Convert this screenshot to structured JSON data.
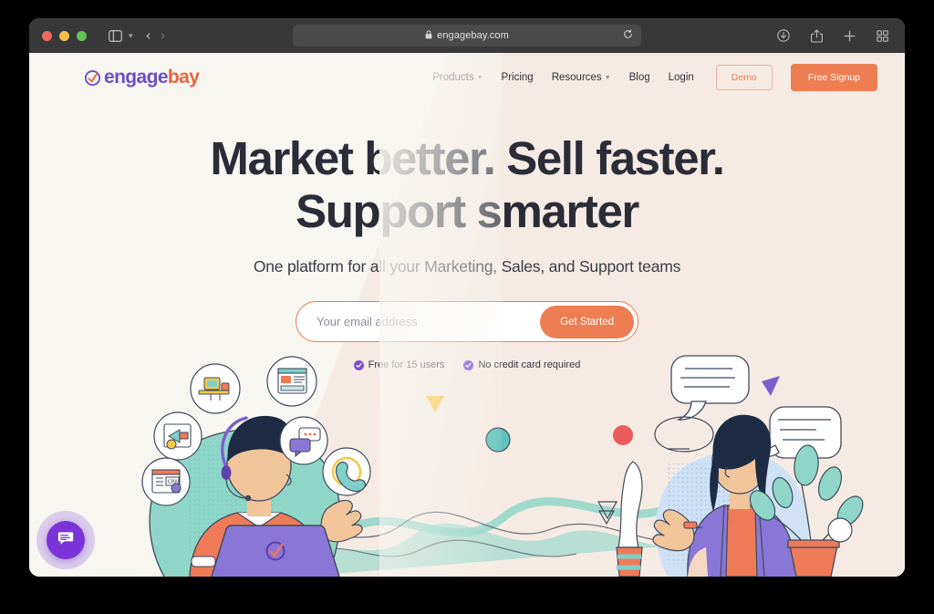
{
  "browser": {
    "url": "engagebay.com",
    "icons": {
      "sidebar": "sidebar-icon",
      "sidebar_caret": "chevron-down-icon",
      "back": "‹",
      "forward": "›",
      "reader": "reader-mode-icon",
      "lock": "lock-icon",
      "reload": "reload-icon",
      "download": "download-icon",
      "share": "share-icon",
      "new_tab": "+",
      "tab_overview": "tab-overview-icon"
    }
  },
  "site": {
    "logo": {
      "part1": "engage",
      "part2": "bay"
    },
    "nav": [
      {
        "label": "Products",
        "has_caret": true
      },
      {
        "label": "Pricing",
        "has_caret": false
      },
      {
        "label": "Resources",
        "has_caret": true
      },
      {
        "label": "Blog",
        "has_caret": false
      },
      {
        "label": "Login",
        "has_caret": false
      }
    ],
    "buttons": {
      "demo": "Demo",
      "signup": "Free Signup"
    }
  },
  "hero": {
    "headline_line1": "Market better. Sell faster.",
    "headline_line2": "Support smarter",
    "subhead": "One platform for all your Marketing, Sales, and Support teams",
    "email_placeholder": "Your email address",
    "email_value": "",
    "cta": "Get Started",
    "badges": [
      "Free for 15 users",
      "No credit card required"
    ]
  },
  "chat": {
    "icon": "chat-bubble-icon"
  },
  "colors": {
    "accent_orange": "#ee7e52",
    "brand_purple": "#6b4fc4",
    "logo_orange": "#e8643c",
    "headline": "#2a2d38",
    "bg_left": "#f7f6f1",
    "bg_right": "#f6ebe4",
    "check_purple": "#7c4dd4",
    "chat_purple": "#7a34d8",
    "mint": "#8fd6c8",
    "teal": "#5fc2bc",
    "illus_purple": "#8a76d6",
    "illus_orange": "#ef7a57",
    "skin": "#f2c49a",
    "hair": "#1d2b44",
    "yellow": "#f7c948",
    "red": "#ec5b5b",
    "lightblue": "#cfe2f5"
  }
}
